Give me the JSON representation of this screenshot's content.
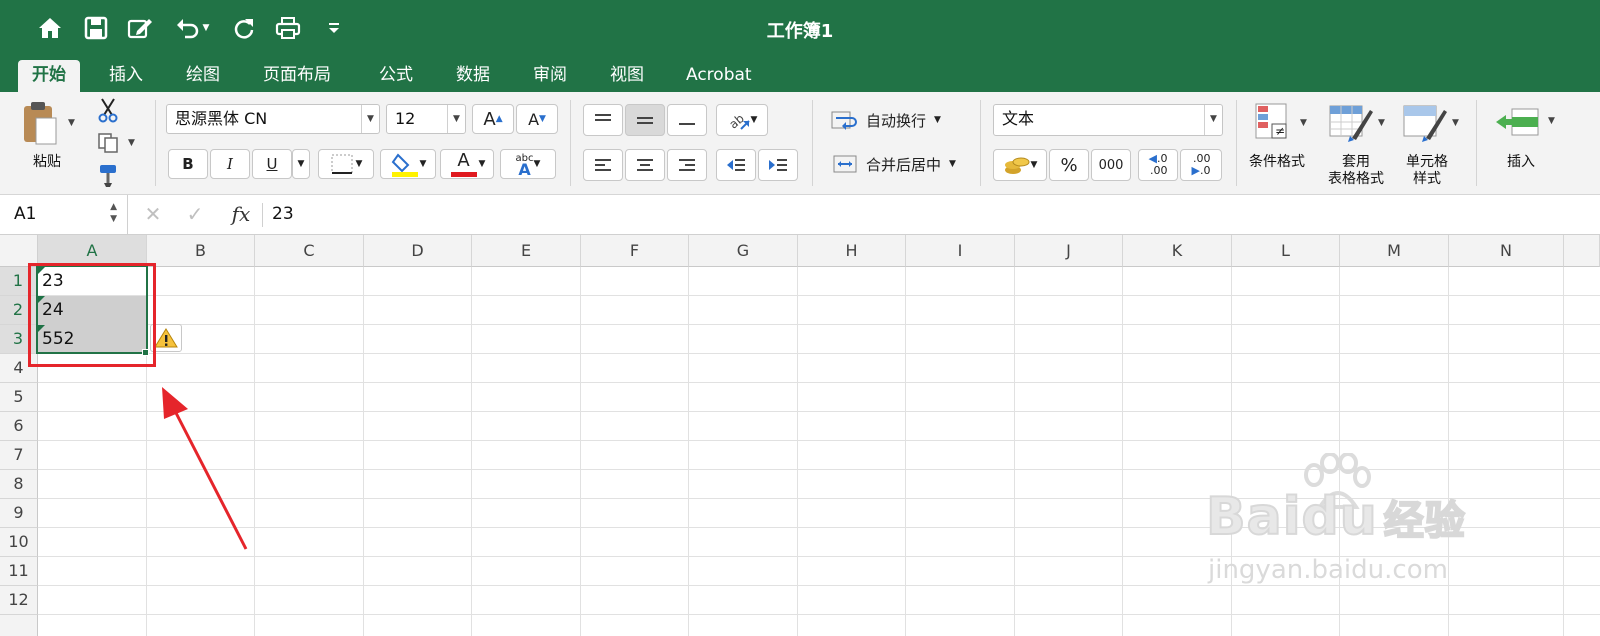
{
  "window": {
    "title": "工作簿1"
  },
  "quick_access": [
    "home-icon",
    "save-icon",
    "edit-icon",
    "undo-icon",
    "redo-icon",
    "print-icon",
    "customize-icon"
  ],
  "tabs": [
    {
      "label": "开始",
      "active": true
    },
    {
      "label": "插入"
    },
    {
      "label": "绘图"
    },
    {
      "label": "页面布局"
    },
    {
      "label": "公式"
    },
    {
      "label": "数据"
    },
    {
      "label": "审阅"
    },
    {
      "label": "视图"
    },
    {
      "label": "Acrobat"
    }
  ],
  "ribbon": {
    "paste_label": "粘贴",
    "font_name": "思源黑体 CN",
    "font_size": "12",
    "wrap_text_label": "自动换行",
    "merge_center_label": "合并后居中",
    "number_format": "文本",
    "percent_label": "%",
    "thousands_label": "000",
    "conditional_format_label": "条件格式",
    "table_format_label": "套用\n表格格式",
    "table_format_line1": "套用",
    "table_format_line2": "表格格式",
    "cell_style_line1": "单元格",
    "cell_style_line2": "样式",
    "insert_label": "插入",
    "bold_label": "B",
    "italic_label": "I",
    "underline_label": "U",
    "font_color_label": "A",
    "abc_label": "abc",
    "inc_decimal": ".00",
    "dec_decimal": ".0",
    "font_color": "#e0191f",
    "fill_color": "#fff200"
  },
  "formula_bar": {
    "name_box": "A1",
    "fx_label": "fx",
    "value": "23"
  },
  "sheet": {
    "columns": [
      "A",
      "B",
      "C",
      "D",
      "E",
      "F",
      "G",
      "H",
      "I",
      "J",
      "K",
      "L",
      "M",
      "N"
    ],
    "rows": [
      "1",
      "2",
      "3",
      "4",
      "5",
      "6",
      "7",
      "8",
      "9",
      "10",
      "11",
      "12"
    ],
    "cells": {
      "A1": "23",
      "A2": "24",
      "A3": "552"
    },
    "selection": "A1:A3",
    "active_cell": "A1",
    "error_indicator": "warning-icon"
  },
  "annotations": {
    "highlight_color": "#e5252b",
    "arrow_color": "#e5252b"
  },
  "watermark": {
    "brand": "Baidu",
    "suffix": "经验",
    "url": "jingyan.baidu.com"
  },
  "colors": {
    "accent": "#217346"
  }
}
